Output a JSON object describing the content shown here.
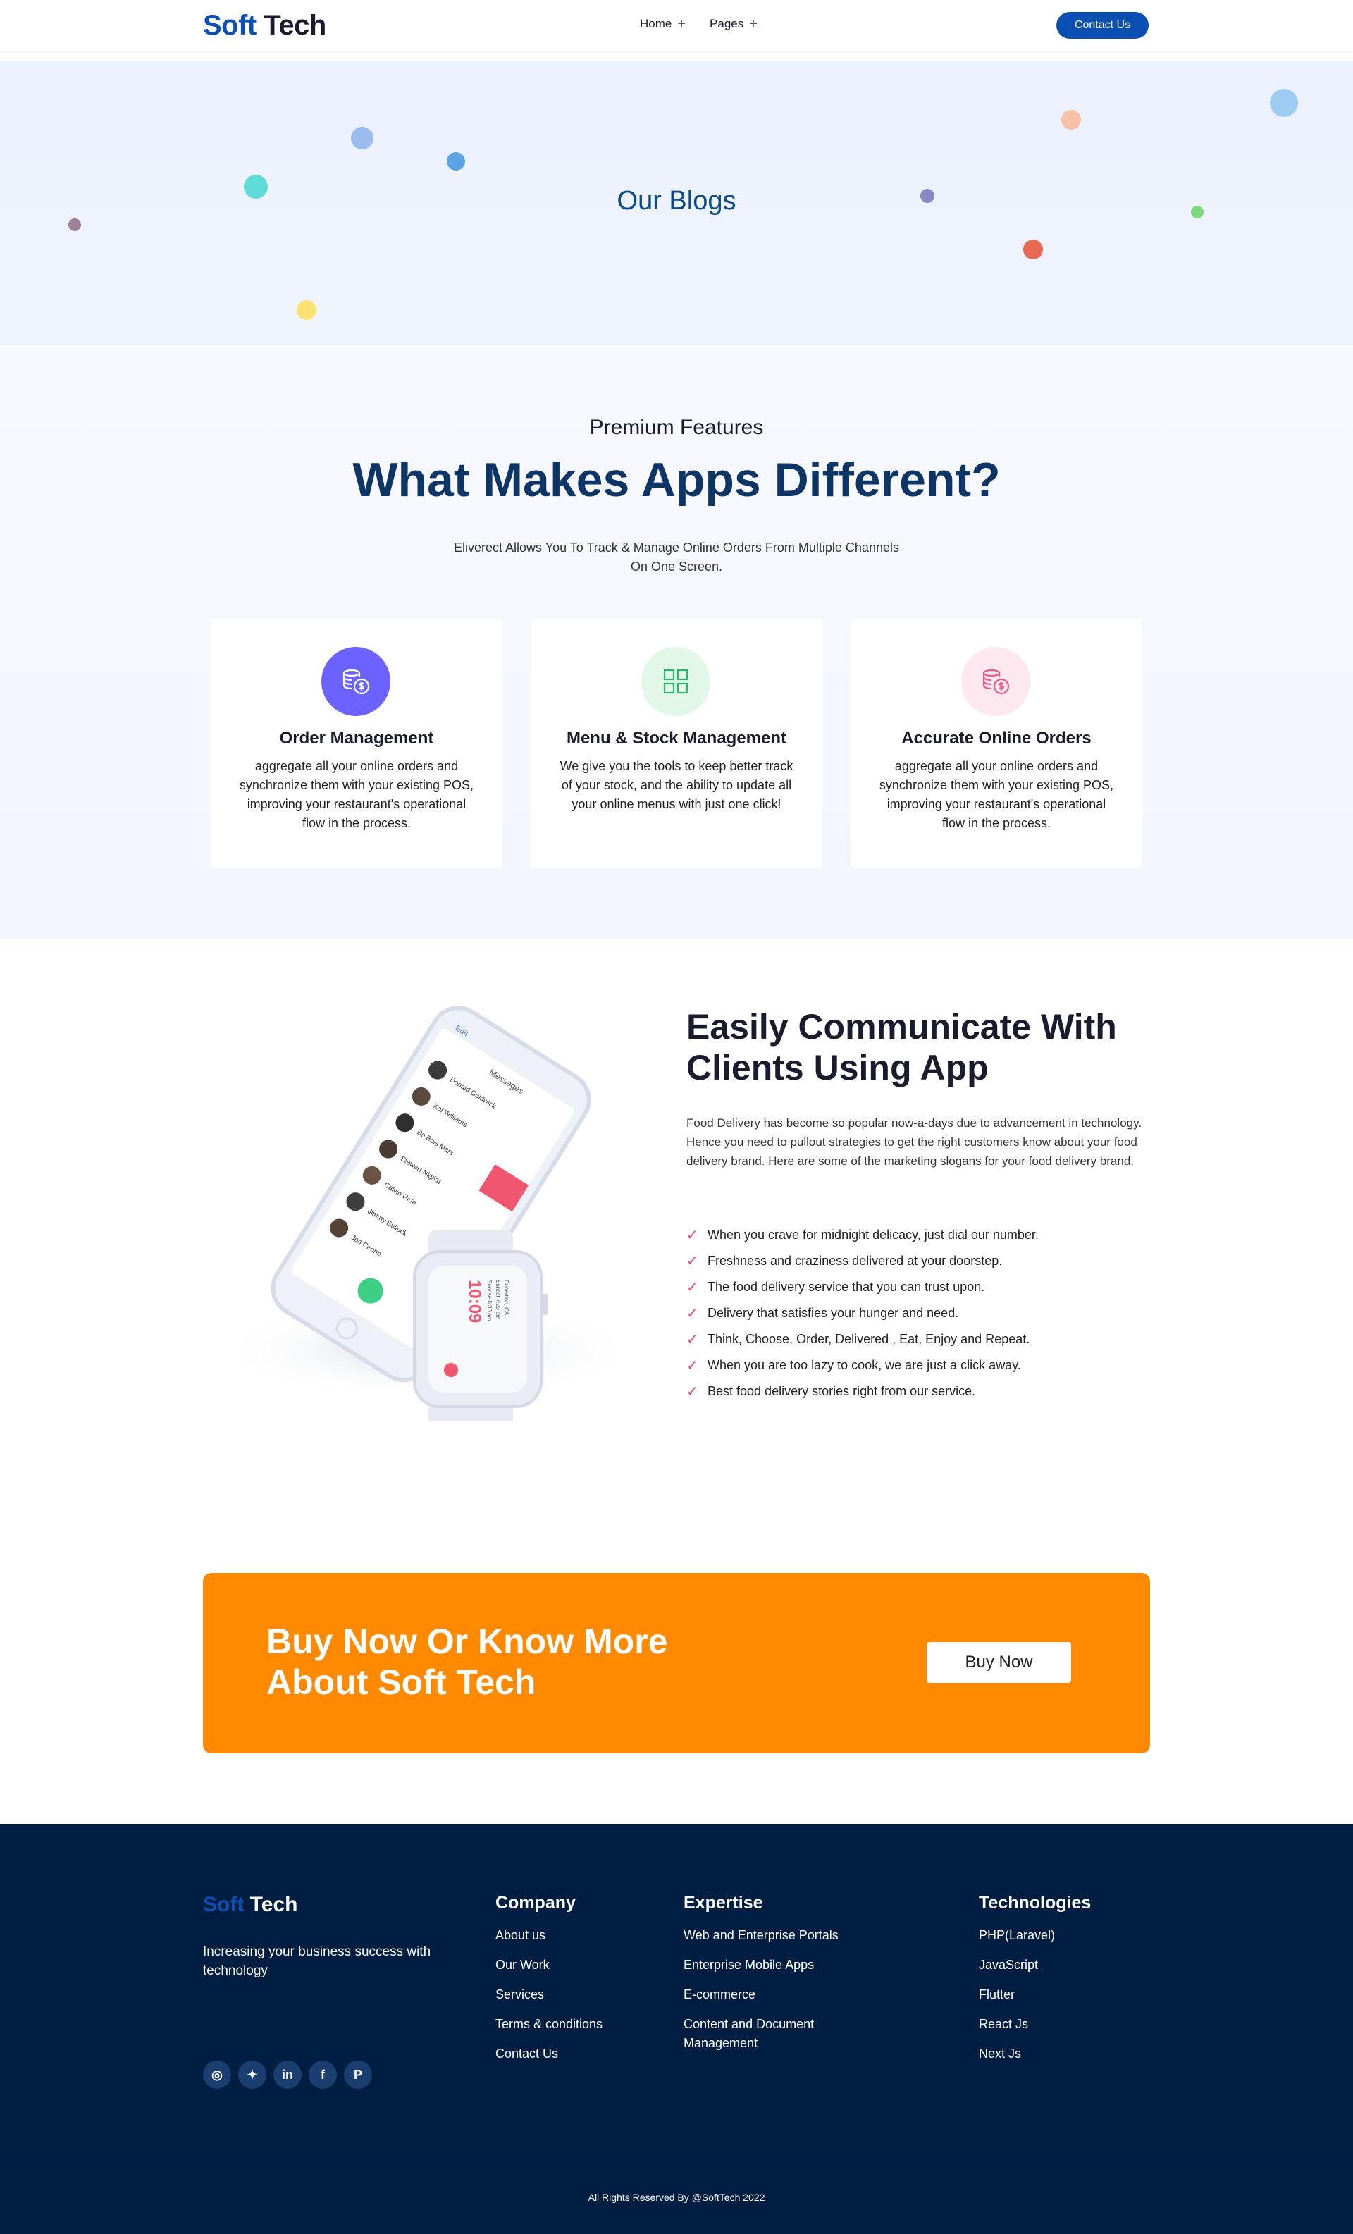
{
  "header": {
    "logo_soft": "Soft",
    "logo_tech": "Tech",
    "nav": [
      {
        "label": "Home",
        "icon": "plus-icon"
      },
      {
        "label": "Pages",
        "icon": "plus-icon"
      }
    ],
    "contact_button": "Contact Us"
  },
  "hero": {
    "title": "Our Blogs"
  },
  "features": {
    "kicker": "Premium Features",
    "title": "What Makes Apps Different?",
    "description": "Eliverect Allows You To Track & Manage Online Orders From Multiple Channels On One Screen.",
    "cards": [
      {
        "icon": "coins-dollar-icon",
        "title": "Order Management",
        "text": "aggregate all your online orders and synchronize them with your existing POS, improving your restaurant's operational flow in the process."
      },
      {
        "icon": "grid-icon",
        "title": "Menu & Stock Management",
        "text": "We give you the tools to keep better track of your stock, and the ability to update all your online menus with just one click!"
      },
      {
        "icon": "coins-dollar-icon",
        "title": "Accurate Online Orders",
        "text": "aggregate all your online orders and synchronize them with your existing POS, improving your restaurant's operational flow in the process."
      }
    ],
    "colors": {
      "card1": "#6c63ff",
      "card2": "#e3f7e8",
      "card3": "#fde8ef"
    }
  },
  "communicate": {
    "title": "Easily Communicate With Clients Using App",
    "description": "Food Delivery has become so popular now-a-days due to advancement in technology. Hence you need to pullout strategies to get the right customers know about your food delivery brand. Here are some of the marketing slogans for your food delivery brand.",
    "checklist": [
      "When you crave for midnight delicacy, just dial our number.",
      "Freshness and craziness delivered at your doorstep.",
      "The food delivery service that you can trust upon.",
      "Delivery that satisfies your hunger and need.",
      "Think, Choose, Order, Delivered , Eat, Enjoy and Repeat.",
      "When you are too lazy to cook, we are just a click away.",
      "Best food delivery stories right from our service."
    ],
    "phone": {
      "header": "Messages",
      "back": "Edit",
      "contacts": [
        "Donald Goldwick",
        "Kai Williams",
        "Bo Bois Mars",
        "Stewart Nigriat",
        "Calvin Gide",
        "Jimmy Bullock",
        "Jon Cirone"
      ],
      "watch_time": "10:09",
      "watch_lines": [
        "Sunrise 6:30 am",
        "Sunset 7:23 pm",
        "Cupertino, CA"
      ]
    }
  },
  "cta": {
    "title": "Buy Now Or Know More About Soft Tech",
    "button": "Buy Now",
    "color": "#ff8a00"
  },
  "footer": {
    "logo_soft": "Soft",
    "logo_tech": "Tech",
    "tagline": "Increasing your business success with technology",
    "socials": [
      {
        "icon": "instagram-icon",
        "glyph": "◎"
      },
      {
        "icon": "twitter-icon",
        "glyph": "✦"
      },
      {
        "icon": "linkedin-icon",
        "glyph": "in"
      },
      {
        "icon": "facebook-icon",
        "glyph": "f"
      },
      {
        "icon": "pinterest-icon",
        "glyph": "P"
      }
    ],
    "columns": [
      {
        "title": "Company",
        "links": [
          "About us",
          "Our Work",
          "Services",
          "Terms & conditions",
          "Contact Us"
        ]
      },
      {
        "title": "Expertise",
        "links": [
          "Web and Enterprise Portals",
          "Enterprise Mobile Apps",
          "E-commerce",
          "Content and Document Management"
        ]
      },
      {
        "title": "Technologies",
        "links": [
          "PHP(Laravel)",
          "JavaScript",
          "Flutter",
          "React Js",
          "Next Js"
        ]
      }
    ],
    "copyright": "All Rights Reserved By @SoftTech 2022",
    "background": "#001d42"
  }
}
